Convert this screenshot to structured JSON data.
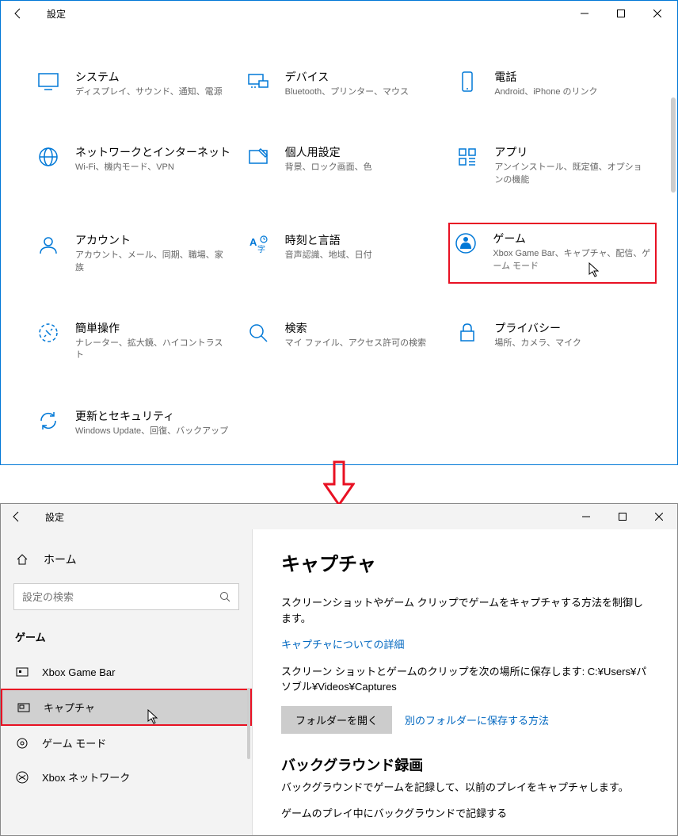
{
  "windowTop": {
    "title": "設定",
    "categories": [
      {
        "id": "system",
        "title": "システム",
        "desc": "ディスプレイ、サウンド、通知、電源"
      },
      {
        "id": "devices",
        "title": "デバイス",
        "desc": "Bluetooth、プリンター、マウス"
      },
      {
        "id": "phone",
        "title": "電話",
        "desc": "Android、iPhone のリンク"
      },
      {
        "id": "network",
        "title": "ネットワークとインターネット",
        "desc": "Wi-Fi、機内モード、VPN"
      },
      {
        "id": "personalization",
        "title": "個人用設定",
        "desc": "背景、ロック画面、色"
      },
      {
        "id": "apps",
        "title": "アプリ",
        "desc": "アンインストール、既定値、オプションの機能"
      },
      {
        "id": "accounts",
        "title": "アカウント",
        "desc": "アカウント、メール、同期、職場、家族"
      },
      {
        "id": "time",
        "title": "時刻と言語",
        "desc": "音声認識、地域、日付"
      },
      {
        "id": "gaming",
        "title": "ゲーム",
        "desc": "Xbox Game Bar、キャプチャ、配信、ゲーム モード",
        "highlighted": true
      },
      {
        "id": "ease",
        "title": "簡単操作",
        "desc": "ナレーター、拡大鏡、ハイコントラスト"
      },
      {
        "id": "search",
        "title": "検索",
        "desc": "マイ ファイル、アクセス許可の検索"
      },
      {
        "id": "privacy",
        "title": "プライバシー",
        "desc": "場所、カメラ、マイク"
      },
      {
        "id": "update",
        "title": "更新とセキュリティ",
        "desc": "Windows Update、回復、バックアップ"
      }
    ]
  },
  "windowBottom": {
    "title": "設定",
    "home": "ホーム",
    "searchPlaceholder": "設定の検索",
    "sectionLabel": "ゲーム",
    "sideItems": [
      {
        "id": "xbox-gamebar",
        "label": "Xbox Game Bar"
      },
      {
        "id": "captures",
        "label": "キャプチャ",
        "selected": true
      },
      {
        "id": "gamemode",
        "label": "ゲーム モード"
      },
      {
        "id": "xbox-network",
        "label": "Xbox ネットワーク"
      }
    ],
    "content": {
      "heading": "キャプチャ",
      "intro": "スクリーンショットやゲーム クリップでゲームをキャプチャする方法を制御します。",
      "learnMore": "キャプチャについての詳細",
      "savePath": "スクリーン ショットとゲームのクリップを次の場所に保存します: C:¥Users¥パソブル¥Videos¥Captures",
      "openFolder": "フォルダーを開く",
      "otherFolder": "別のフォルダーに保存する方法",
      "bgHeading": "バックグラウンド録画",
      "bgDesc": "バックグラウンドでゲームを記録して、以前のプレイをキャプチャします。",
      "bgToggle": "ゲームのプレイ中にバックグラウンドで記録する"
    }
  }
}
